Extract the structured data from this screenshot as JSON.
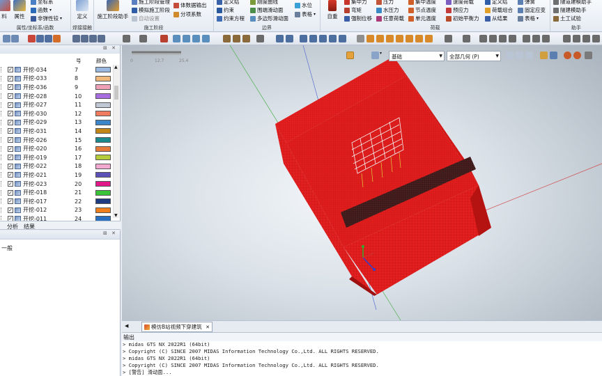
{
  "ribbon": {
    "left_buttons": {
      "material_label": "料",
      "property_label": "属性",
      "function_label": "函数",
      "nonlinear_label": "非弹性铰",
      "cut_top": "坐标系"
    },
    "group_property_label": "属性/坐标系/函数",
    "define_label": "定义",
    "group_weld_label": "焊接接触",
    "stage_label": "施工阶段助手",
    "stage_small": [
      "施工阶段管理",
      "模拟施工阶段",
      "自动设置"
    ],
    "stage_small2": [
      "体数据输出",
      "分项系数"
    ],
    "group_stage_label": "施工阶段",
    "boundary_col1": [
      "定义结",
      "约束",
      "约束方程"
    ],
    "boundary_col2": [
      "刚度曲线",
      "围端滑动面",
      "多边形滑动面"
    ],
    "boundary_col3": [
      "水位",
      "表格"
    ],
    "group_boundary_label": "边界",
    "weight_label": "自重",
    "load_col1": [
      "集中力",
      "弯矩",
      "强制位移"
    ],
    "load_col2": [
      "压力",
      "水压力",
      "任意荷载"
    ],
    "load_col3": [
      "集中温度",
      "节点温度",
      "单元温度"
    ],
    "load_col4": [
      "速度荷载",
      "预应力",
      "初始平衡力"
    ],
    "load_col5": [
      "定义结",
      "荷载组合",
      "从结果"
    ],
    "load_col6": [
      "弹簧",
      "固定应变",
      "表格"
    ],
    "group_load_label": "荷载",
    "assist_col": [
      "隧道建模助手",
      "隧建模助手",
      "土工试验"
    ],
    "group_assist_label": "助手"
  },
  "tree": {
    "col_number": "号",
    "col_color": "颜色",
    "items": [
      {
        "name": "开挖-034",
        "num": "7",
        "color": "#9ab7e0"
      },
      {
        "name": "开挖-033",
        "num": "8",
        "color": "#f2b97d"
      },
      {
        "name": "开挖-036",
        "num": "9",
        "color": "#ef9fb6"
      },
      {
        "name": "开挖-028",
        "num": "10",
        "color": "#a86de0"
      },
      {
        "name": "开挖-027",
        "num": "11",
        "color": "#bfc8d4"
      },
      {
        "name": "开挖-030",
        "num": "12",
        "color": "#f07b5e"
      },
      {
        "name": "开挖-029",
        "num": "13",
        "color": "#3a86c9"
      },
      {
        "name": "开挖-031",
        "num": "14",
        "color": "#c28618"
      },
      {
        "name": "开挖-026",
        "num": "15",
        "color": "#1a8a8e"
      },
      {
        "name": "开挖-020",
        "num": "16",
        "color": "#e67a3a"
      },
      {
        "name": "开挖-019",
        "num": "17",
        "color": "#b7cc3a"
      },
      {
        "name": "开挖-022",
        "num": "18",
        "color": "#f2a8cf"
      },
      {
        "name": "开挖-021",
        "num": "19",
        "color": "#5b4fb8"
      },
      {
        "name": "开挖-023",
        "num": "20",
        "color": "#e0188a"
      },
      {
        "name": "开挖-018",
        "num": "21",
        "color": "#39c43a"
      },
      {
        "name": "开挖-017",
        "num": "22",
        "color": "#1e3a80"
      },
      {
        "name": "开挖-012",
        "num": "23",
        "color": "#f07e1a"
      },
      {
        "name": "开挖-011",
        "num": "24",
        "color": "#2a6fc0"
      }
    ]
  },
  "panel_tabs": {
    "tab_analysis": "分析",
    "tab_result": "结果"
  },
  "property_panel": {
    "general_label": "一般"
  },
  "viewport": {
    "scale_ticks": [
      "0",
      "12.7",
      "25.4"
    ],
    "select_view": "基础",
    "select_geometry": "全部几何 (P)"
  },
  "document": {
    "tab_title": "模仿B站视频下穿建筑"
  },
  "output": {
    "title": "输出",
    "lines": [
      "> midas GTS NX 2022R1 (64bit)",
      "> Copyright (C) SINCE 2007 MIDAS Information Technology Co.,Ltd. ALL RIGHTS RESERVED.",
      "> midas GTS NX 2022R1 (64bit)",
      "> Copyright (C) SINCE 2007 MIDAS Information Technology Co.,Ltd. ALL RIGHTS RESERVED.",
      "> [警告] 滑动面..."
    ]
  }
}
